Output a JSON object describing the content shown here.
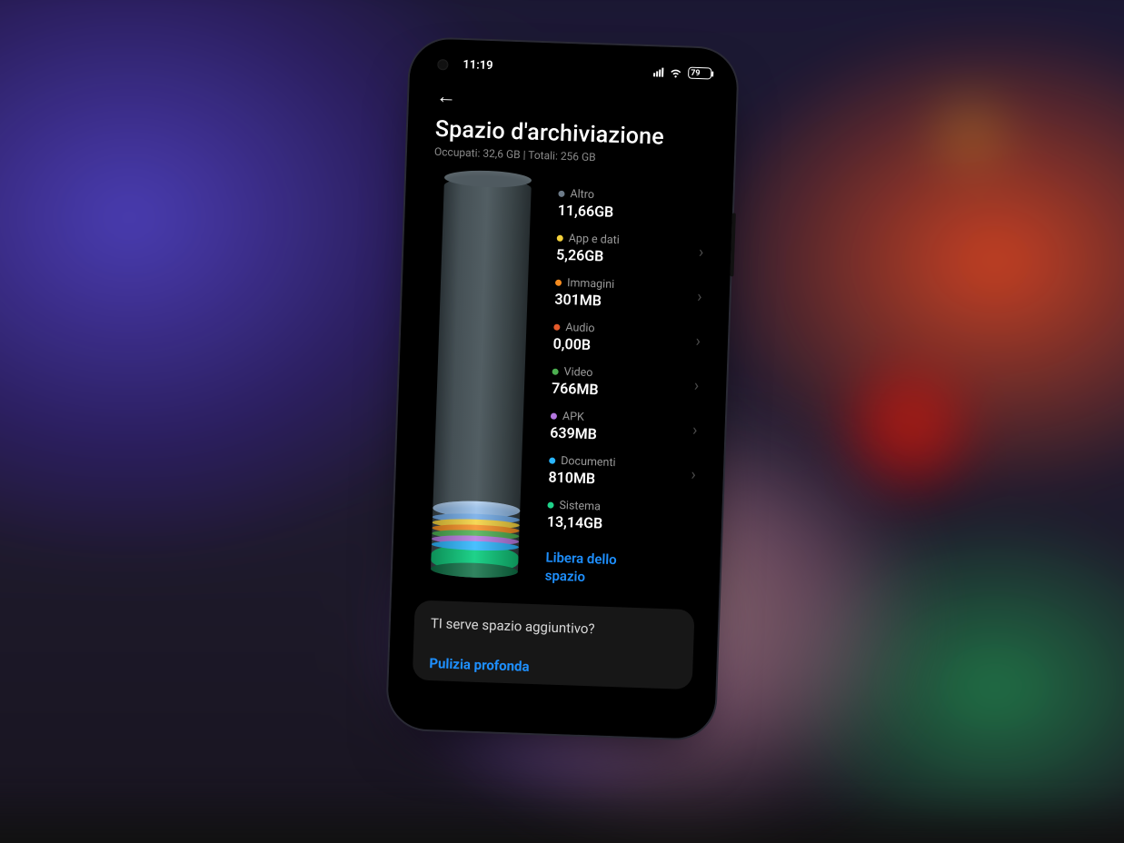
{
  "statusbar": {
    "time": "11:19",
    "battery": "79"
  },
  "header": {
    "title": "Spazio d'archiviazione",
    "subtitle": "Occupati: 32,6 GB | Totali: 256 GB"
  },
  "categories": [
    {
      "label": "Altro",
      "value": "11,66GB",
      "color": "#6d7b89",
      "clickable": false
    },
    {
      "label": "App e dati",
      "value": "5,26GB",
      "color": "#f4d13b",
      "clickable": true
    },
    {
      "label": "Immagini",
      "value": "301MB",
      "color": "#f58b1f",
      "clickable": true
    },
    {
      "label": "Audio",
      "value": "0,00B",
      "color": "#e55a2b",
      "clickable": true
    },
    {
      "label": "Video",
      "value": "766MB",
      "color": "#4caf50",
      "clickable": true
    },
    {
      "label": "APK",
      "value": "639MB",
      "color": "#b477e0",
      "clickable": true
    },
    {
      "label": "Documenti",
      "value": "810MB",
      "color": "#2ab6ff",
      "clickable": true
    },
    {
      "label": "Sistema",
      "value": "13,14GB",
      "color": "#1fd28a",
      "clickable": false
    }
  ],
  "free_space_label": "Libera dello spazio",
  "promo": {
    "title": "TI serve spazio aggiuntivo?",
    "deep_clean": "Pulizia profonda"
  },
  "chart_data": {
    "type": "bar",
    "title": "Spazio d'archiviazione",
    "total_gb": 256,
    "used_gb": 32.6,
    "series": [
      {
        "name": "Altro",
        "value_gb": 11.66,
        "color": "#6d7b89"
      },
      {
        "name": "App e dati",
        "value_gb": 5.26,
        "color": "#f4d13b"
      },
      {
        "name": "Immagini",
        "value_gb": 0.301,
        "color": "#f58b1f"
      },
      {
        "name": "Audio",
        "value_gb": 0.0,
        "color": "#e55a2b"
      },
      {
        "name": "Video",
        "value_gb": 0.766,
        "color": "#4caf50"
      },
      {
        "name": "APK",
        "value_gb": 0.639,
        "color": "#b477e0"
      },
      {
        "name": "Documenti",
        "value_gb": 0.81,
        "color": "#2ab6ff"
      },
      {
        "name": "Sistema",
        "value_gb": 13.14,
        "color": "#1fd28a"
      }
    ]
  }
}
